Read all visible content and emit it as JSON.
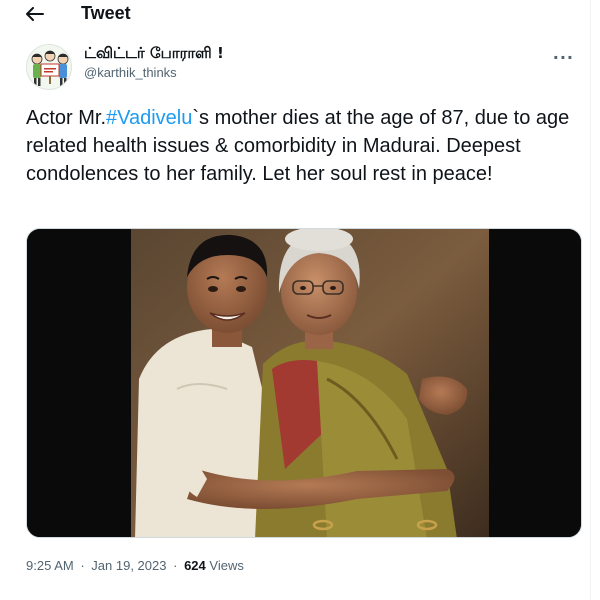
{
  "header": {
    "title": "Tweet",
    "back_icon": "arrow-left-icon"
  },
  "author": {
    "display_name": "ட்விட்டர் போராளி !",
    "handle": "@karthik_thinks",
    "more_icon": "more-horizontal-icon",
    "more_glyph": "···"
  },
  "tweet": {
    "text_before": "Actor Mr.",
    "hashtag": "#Vadivelu",
    "text_after": "`s mother dies at the age of 87, due to age related health issues & comorbidity in Madurai. Deepest condolences to her family. Let her soul rest in peace!"
  },
  "meta": {
    "time": "9:25 AM",
    "separator": "·",
    "date": "Jan 19, 2023",
    "views_count": "624",
    "views_label": "Views"
  },
  "colors": {
    "accent": "#1d9bf0",
    "text": "#0f1419",
    "secondary": "#536471"
  }
}
